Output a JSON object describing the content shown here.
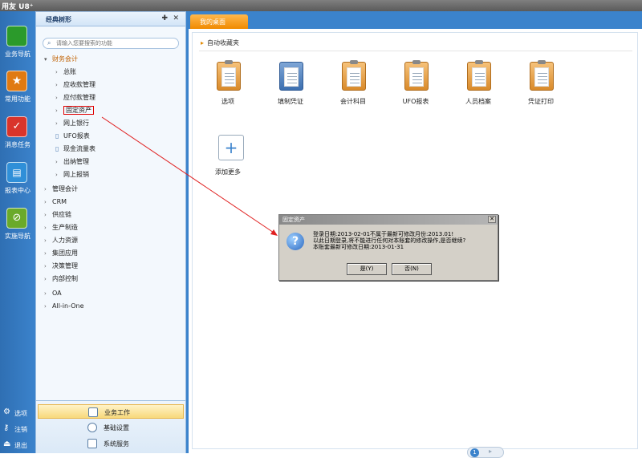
{
  "app": {
    "brand": "用友 U8⁺"
  },
  "leftnav": {
    "items": [
      {
        "label": "业务导航",
        "icon": "business-nav-icon",
        "color": "#2b9a2b"
      },
      {
        "label": "常用功能",
        "icon": "star-icon",
        "color": "#e07a12"
      },
      {
        "label": "消息任务",
        "icon": "message-task-icon",
        "color": "#d9342b"
      },
      {
        "label": "报表中心",
        "icon": "report-icon",
        "color": "#2f8fd8"
      },
      {
        "label": "实施导航",
        "icon": "compass-icon",
        "color": "#6aaa2a"
      }
    ],
    "bottom": [
      {
        "label": "选项",
        "icon": "gear-icon"
      },
      {
        "label": "注销",
        "icon": "key-icon"
      },
      {
        "label": "退出",
        "icon": "exit-icon"
      }
    ]
  },
  "panel": {
    "title": "经典树形",
    "search_placeholder": "请输入您要搜索的功能",
    "tree": [
      {
        "label": "财务会计",
        "level": 0,
        "expanded": true
      },
      {
        "label": "总账",
        "level": 1
      },
      {
        "label": "应收款管理",
        "level": 1
      },
      {
        "label": "应付款管理",
        "level": 1
      },
      {
        "label": "固定资产",
        "level": 1,
        "highlighted": true
      },
      {
        "label": "网上银行",
        "level": 1
      },
      {
        "label": "UFO报表",
        "level": 1,
        "doc": true
      },
      {
        "label": "现金流量表",
        "level": 1,
        "doc": true
      },
      {
        "label": "出纳管理",
        "level": 1
      },
      {
        "label": "网上报销",
        "level": 1
      },
      {
        "label": "管理会计",
        "level": 0
      },
      {
        "label": "CRM",
        "level": 0
      },
      {
        "label": "供应链",
        "level": 0
      },
      {
        "label": "生产制造",
        "level": 0
      },
      {
        "label": "人力资源",
        "level": 0
      },
      {
        "label": "集团应用",
        "level": 0
      },
      {
        "label": "决策管理",
        "level": 0
      },
      {
        "label": "内部控制",
        "level": 0
      },
      {
        "label": "OA",
        "level": 0
      },
      {
        "label": "All-in-One",
        "level": 0
      }
    ],
    "footer": [
      {
        "label": "业务工作",
        "active": true
      },
      {
        "label": "基础设置",
        "active": false
      },
      {
        "label": "系统服务",
        "active": false
      }
    ]
  },
  "content": {
    "tab": "我的桌面",
    "favorites_title": "自动收藏夹",
    "apps": [
      "选项",
      "填制凭证",
      "会计科目",
      "UFO报表",
      "人员档案",
      "凭证打印"
    ],
    "add_more": "添加更多",
    "page": "1"
  },
  "dialog": {
    "title": "固定资产",
    "close": "✕",
    "lines": [
      "登录日期:2013-02-01不属于最新可修改月份:2013.01!",
      "以此日期登录,将不能进行任何对本账套的修改操作,是否继续?",
      "本账套最新可修改日期:2013-01-31"
    ],
    "yes": "是(Y)",
    "no": "否(N)"
  },
  "colors": {
    "accent": "#3b83cc",
    "tab": "#f08a00",
    "highlight": "#e00000"
  }
}
